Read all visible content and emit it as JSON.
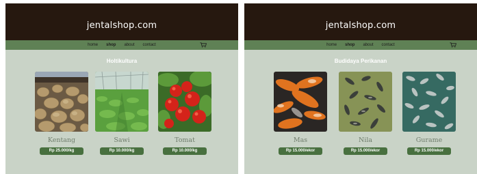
{
  "panels": [
    {
      "site_title": "jentalshop.com",
      "nav": [
        "home",
        "shop",
        "about",
        "contact"
      ],
      "active_nav": "shop",
      "cart_icon": "cart-icon",
      "section_title": "Holtikultura",
      "products": [
        {
          "name": "Kentang",
          "price": "Rp 25.000/kg",
          "image": "potatoes"
        },
        {
          "name": "Sawi",
          "price": "Rp 10.000/kg",
          "image": "mustard-greens-greenhouse"
        },
        {
          "name": "Tomat",
          "price": "Rp 10.000/kg",
          "image": "tomatoes"
        }
      ]
    },
    {
      "site_title": "jentalshop.com",
      "nav": [
        "home",
        "shop",
        "about",
        "contact"
      ],
      "active_nav": "shop",
      "cart_icon": "cart-icon",
      "section_title": "Budidaya Perikanan",
      "products": [
        {
          "name": "Mas",
          "price": "Rp 15.000/ekor",
          "image": "koi-fish"
        },
        {
          "name": "Nila",
          "price": "Rp 15.000/ekor",
          "image": "tilapia"
        },
        {
          "name": "Gurame",
          "price": "Rp 15.000/ekor",
          "image": "gourami"
        }
      ]
    }
  ],
  "colors": {
    "header_bg": "#26180f",
    "nav_bg": "#5f8155",
    "page_bg": "#c9d3c7",
    "price_badge": "#48703f",
    "product_name": "#6f7d6c"
  }
}
